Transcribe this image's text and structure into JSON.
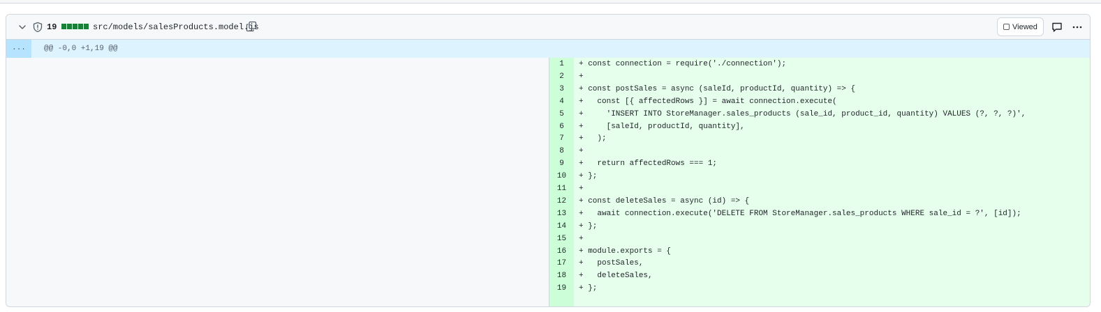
{
  "file": {
    "additions": "19",
    "path": "src/models/salesProducts.model.js",
    "viewed_label": "Viewed",
    "hunk_expand_label": "...",
    "hunk_header": "@@ -0,0 +1,19 @@"
  },
  "colors": {
    "addition_bg": "#e6ffec",
    "addition_gutter": "#ccffd8",
    "hunk_bg": "#ddf4ff",
    "diffstat": "#1a7f37"
  },
  "lines": [
    {
      "n": "1",
      "code": "+ const connection = require('./connection');"
    },
    {
      "n": "2",
      "code": "+"
    },
    {
      "n": "3",
      "code": "+ const postSales = async (saleId, productId, quantity) => {"
    },
    {
      "n": "4",
      "code": "+   const [{ affectedRows }] = await connection.execute("
    },
    {
      "n": "5",
      "code": "+     'INSERT INTO StoreManager.sales_products (sale_id, product_id, quantity) VALUES (?, ?, ?)',"
    },
    {
      "n": "6",
      "code": "+     [saleId, productId, quantity],"
    },
    {
      "n": "7",
      "code": "+   );"
    },
    {
      "n": "8",
      "code": "+"
    },
    {
      "n": "9",
      "code": "+   return affectedRows === 1;"
    },
    {
      "n": "10",
      "code": "+ };"
    },
    {
      "n": "11",
      "code": "+"
    },
    {
      "n": "12",
      "code": "+ const deleteSales = async (id) => {"
    },
    {
      "n": "13",
      "code": "+   await connection.execute('DELETE FROM StoreManager.sales_products WHERE sale_id = ?', [id]);"
    },
    {
      "n": "14",
      "code": "+ };"
    },
    {
      "n": "15",
      "code": "+"
    },
    {
      "n": "16",
      "code": "+ module.exports = {"
    },
    {
      "n": "17",
      "code": "+   postSales,"
    },
    {
      "n": "18",
      "code": "+   deleteSales,"
    },
    {
      "n": "19",
      "code": "+ };"
    }
  ]
}
